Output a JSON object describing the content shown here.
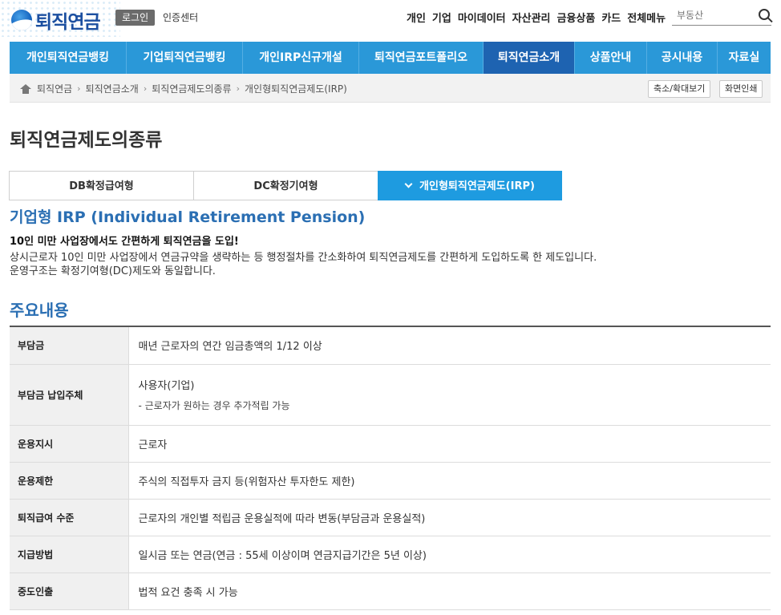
{
  "header": {
    "logo_text": "퇴직연금",
    "login_label": "로그인",
    "cert_label": "인증센터",
    "util_nav": [
      "개인",
      "기업",
      "마이데이터",
      "자산관리",
      "금융상품",
      "카드",
      "전체메뉴"
    ],
    "search_placeholder": "부동산"
  },
  "gnb": {
    "items": [
      {
        "label": "개인퇴직연금뱅킹",
        "width": 146
      },
      {
        "label": "기업퇴직연금뱅킹",
        "width": 145
      },
      {
        "label": "개인IRP신규개설",
        "width": 145
      },
      {
        "label": "퇴직연금포트폴리오",
        "width": 155
      },
      {
        "label": "퇴직연금소개",
        "width": 114
      },
      {
        "label": "상품안내",
        "width": 90
      },
      {
        "label": "공시내용",
        "width": 88
      },
      {
        "label": "자료실",
        "width": 66
      }
    ],
    "active_index": 4
  },
  "breadcrumb": {
    "items": [
      "퇴직연금",
      "퇴직연금소개",
      "퇴직연금제도의종류",
      "개인형퇴직연금제도(IRP)"
    ],
    "zoom_label": "축소/확대보기",
    "print_label": "화면인쇄"
  },
  "page_title": "퇴직연금제도의종류",
  "tabs": [
    {
      "label": "DB확정급여형",
      "active": false
    },
    {
      "label": "DC확정기여형",
      "active": false
    },
    {
      "label": "개인형퇴직연금제도(IRP)",
      "active": true
    }
  ],
  "content": {
    "sub_title": "기업형 IRP (Individual Retirement Pension)",
    "lead": "10인 미만 사업장에서도 간편하게 퇴직연금을 도입!",
    "desc_line1": "상시근로자 10인 미만 사업장에서 연금규약을 생략하는 등 행정절차를 간소화하여 퇴직연금제도를 간편하게 도입하도록 한 제도입니다.",
    "desc_line2": "운영구조는 확정기여형(DC)제도와 동일합니다.",
    "section_title": "주요내용"
  },
  "table": {
    "rows": [
      {
        "label": "부담금",
        "value": "매년 근로자의 연간 임금총액의 1/12 이상",
        "height": 47
      },
      {
        "label": "부담금 납입주체",
        "value": "사용자(기업)",
        "note": "- 근로자가 원하는 경우 추가적립 가능",
        "height": 76
      },
      {
        "label": "운용지시",
        "value": "근로자",
        "height": 46
      },
      {
        "label": "운용제한",
        "value": "주식의 직접투자 금지 등(위험자산 투자한도 제한)",
        "height": 46
      },
      {
        "label": "퇴직급여 수준",
        "value": "근로자의 개인별 적립금 운용실적에 따라 변동(부담금과 운용실적)",
        "height": 46
      },
      {
        "label": "지급방법",
        "value": "일시금 또는 연금(연금 : 55세 이상이며 연금지급기간은 5년 이상)",
        "height": 46
      },
      {
        "label": "중도인출",
        "value": "법적 요건 충족 시 가능",
        "height": 46
      }
    ]
  }
}
